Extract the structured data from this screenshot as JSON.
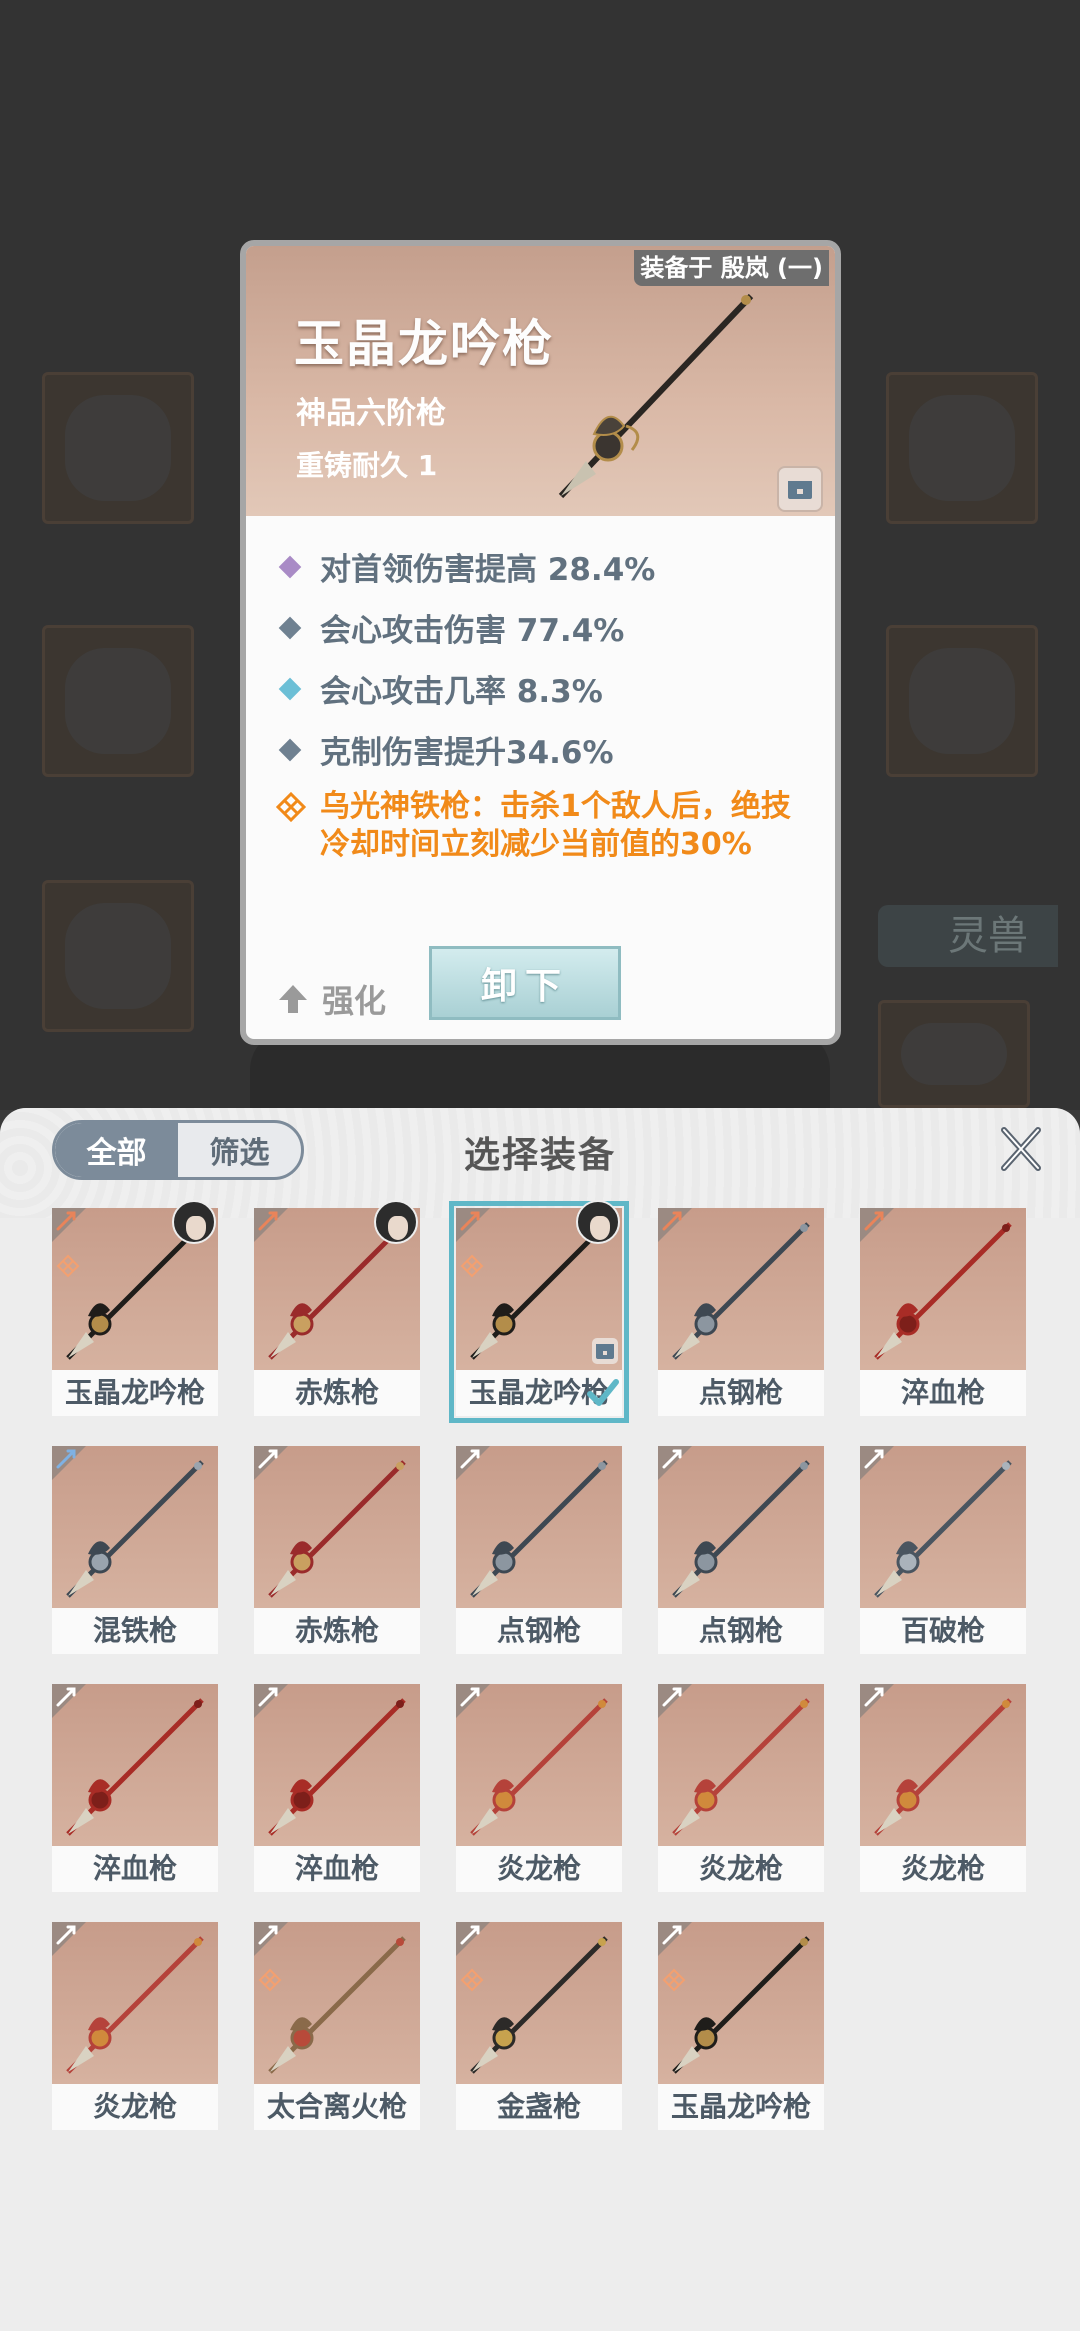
{
  "background": {
    "pet_tab_label": "灵兽"
  },
  "card": {
    "equipped_on": "装备于 殷岚 (一)",
    "title": "玉晶龙吟枪",
    "grade": "神品六阶枪",
    "reforge": "重铸耐久 1",
    "attributes": [
      {
        "text": "对首领伤害提高 28.4%",
        "color": "#a98bc6"
      },
      {
        "text": "会心攻击伤害 77.4%",
        "color": "#6f8191"
      },
      {
        "text": "会心攻击几率 8.3%",
        "color": "#6cbfd6"
      },
      {
        "text": "克制伤害提升34.6%",
        "color": "#6f8191"
      }
    ],
    "special_line1": "乌光神铁枪：击杀1个敌人后，绝技",
    "special_line2": "冷却时间立刻减少当前值的30%",
    "upgrade_label": "强化",
    "unequip_label": "卸下"
  },
  "sheet": {
    "title": "选择装备",
    "tab_all": "全部",
    "tab_filter": "筛选"
  },
  "items": [
    {
      "name": "玉晶龙吟枪",
      "tier": "orange",
      "avatar": true,
      "skill": true,
      "blade": "#1f1d1a",
      "accent": "#b38d4a"
    },
    {
      "name": "赤炼枪",
      "tier": "orange",
      "avatar": true,
      "skill": false,
      "blade": "#9a2b2b",
      "accent": "#c9a060"
    },
    {
      "name": "玉晶龙吟枪",
      "tier": "orange",
      "avatar": true,
      "skill": true,
      "blade": "#1f1d1a",
      "accent": "#b38d4a",
      "selected": true,
      "locked": true
    },
    {
      "name": "点钢枪",
      "tier": "orange",
      "avatar": false,
      "skill": false,
      "blade": "#3e4852",
      "accent": "#8c96a0"
    },
    {
      "name": "淬血枪",
      "tier": "orange",
      "avatar": false,
      "skill": false,
      "blade": "#a82c26",
      "accent": "#7d1f1a"
    },
    {
      "name": "混铁枪",
      "tier": "blue",
      "avatar": false,
      "skill": false,
      "blade": "#3e4852",
      "accent": "#9aa4ae"
    },
    {
      "name": "赤炼枪",
      "tier": "grey",
      "avatar": false,
      "skill": false,
      "blade": "#9a2b2b",
      "accent": "#c9a060"
    },
    {
      "name": "点钢枪",
      "tier": "grey",
      "avatar": false,
      "skill": false,
      "blade": "#3e4852",
      "accent": "#8c96a0"
    },
    {
      "name": "点钢枪",
      "tier": "grey",
      "avatar": false,
      "skill": false,
      "blade": "#3e4852",
      "accent": "#8c96a0"
    },
    {
      "name": "百破枪",
      "tier": "grey",
      "avatar": false,
      "skill": false,
      "blade": "#4a5560",
      "accent": "#aab3bb"
    },
    {
      "name": "淬血枪",
      "tier": "grey",
      "avatar": false,
      "skill": false,
      "blade": "#a82c26",
      "accent": "#7d1f1a"
    },
    {
      "name": "淬血枪",
      "tier": "grey",
      "avatar": false,
      "skill": false,
      "blade": "#a82c26",
      "accent": "#7d1f1a"
    },
    {
      "name": "炎龙枪",
      "tier": "grey",
      "avatar": false,
      "skill": false,
      "blade": "#b5423a",
      "accent": "#d08a3c"
    },
    {
      "name": "炎龙枪",
      "tier": "grey",
      "avatar": false,
      "skill": false,
      "blade": "#b5423a",
      "accent": "#d08a3c"
    },
    {
      "name": "炎龙枪",
      "tier": "grey",
      "avatar": false,
      "skill": false,
      "blade": "#b5423a",
      "accent": "#d08a3c"
    },
    {
      "name": "炎龙枪",
      "tier": "grey",
      "avatar": false,
      "skill": false,
      "blade": "#b5423a",
      "accent": "#d08a3c"
    },
    {
      "name": "太合离火枪",
      "tier": "grey",
      "avatar": false,
      "skill": true,
      "blade": "#8a6a4a",
      "accent": "#b84a3a"
    },
    {
      "name": "金盏枪",
      "tier": "grey",
      "avatar": false,
      "skill": true,
      "blade": "#2c2a28",
      "accent": "#c7a24e"
    },
    {
      "name": "玉晶龙吟枪",
      "tier": "grey",
      "avatar": false,
      "skill": true,
      "blade": "#1f1d1a",
      "accent": "#b38d4a"
    }
  ],
  "colors": {
    "accent_teal": "#5fb7c7",
    "special_orange": "#f18a19",
    "tier_orange": "#e9845a",
    "tier_blue": "#7fb1e3",
    "tier_grey": "#ffffff"
  },
  "icons": {
    "upgrade": "arrow-up-icon",
    "close": "close-x-icon",
    "lock": "lock-icon",
    "check": "check-icon",
    "skill": "skill-diamond-icon"
  }
}
